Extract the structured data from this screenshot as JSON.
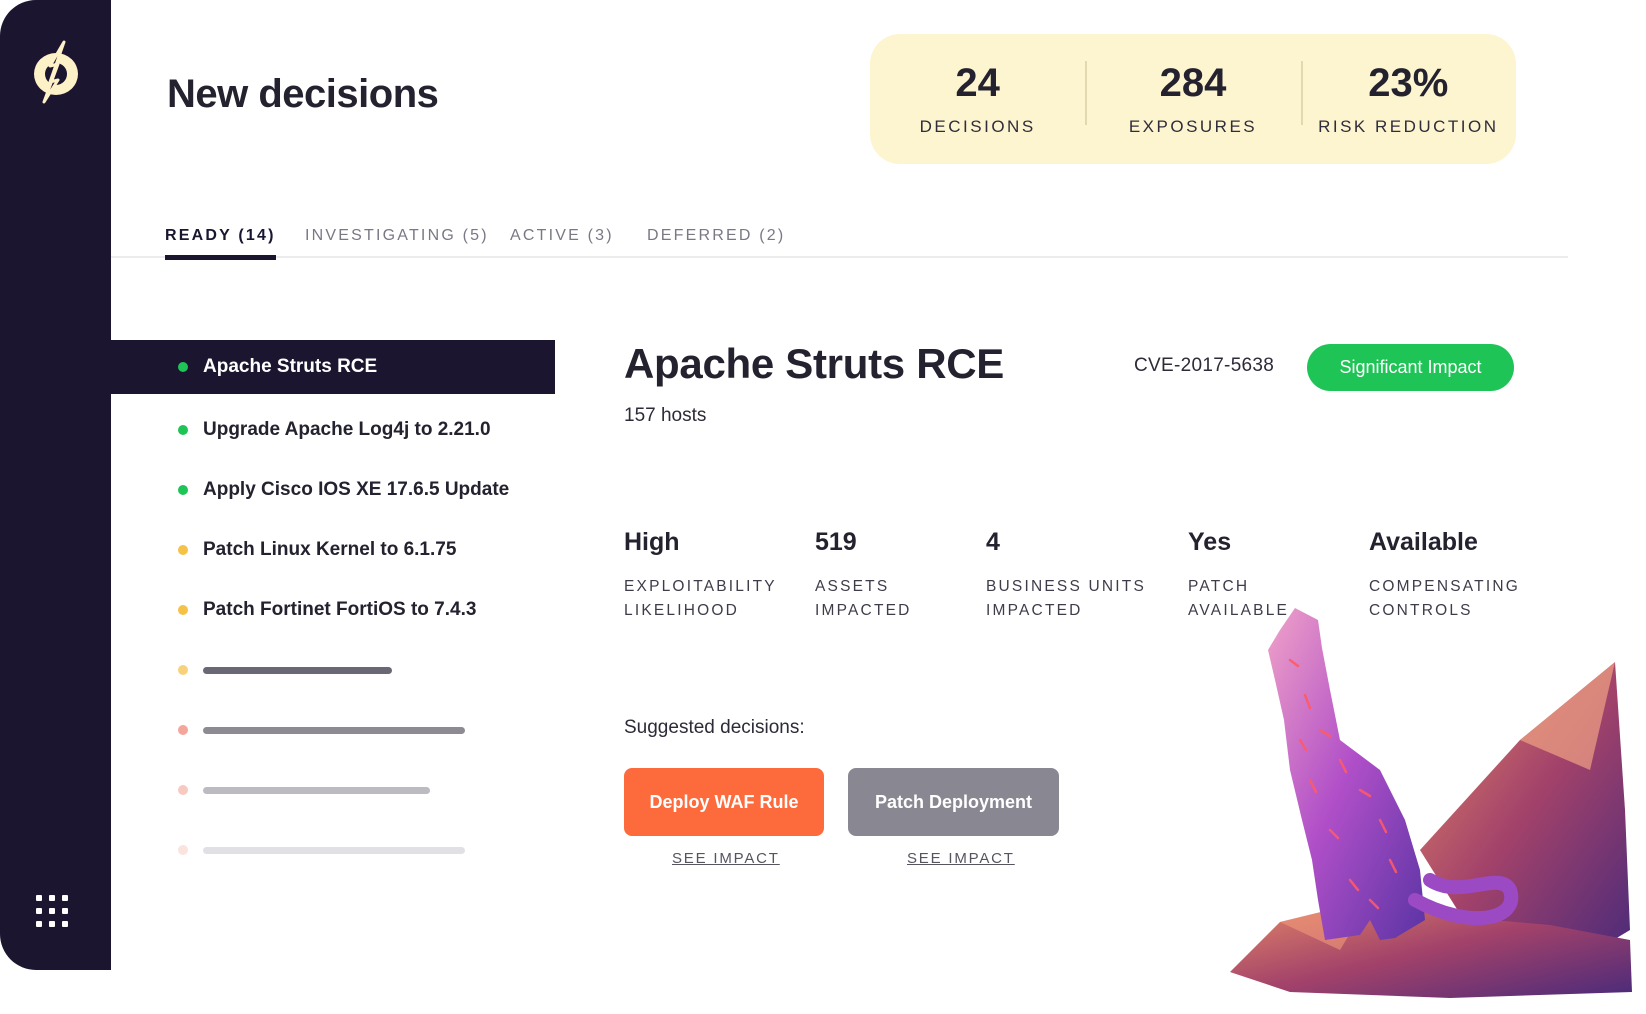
{
  "sidebar": {
    "logo": "slashed-zero-logo",
    "menu_icon": "grid-icon"
  },
  "page_title": "New decisions",
  "stats": [
    {
      "value": "24",
      "label": "DECISIONS"
    },
    {
      "value": "284",
      "label": "EXPOSURES"
    },
    {
      "value": "23%",
      "label": "RISK REDUCTION"
    }
  ],
  "tabs": [
    {
      "label": "READY (14)",
      "active": true
    },
    {
      "label": "INVESTIGATING (5)",
      "active": false
    },
    {
      "label": "ACTIVE (3)",
      "active": false
    },
    {
      "label": "DEFERRED (2)",
      "active": false
    }
  ],
  "decisions": [
    {
      "label": "Apache Struts RCE",
      "dot_color": "#1ec455",
      "selected": true
    },
    {
      "label": "Upgrade Apache Log4j to 2.21.0",
      "dot_color": "#1ec455"
    },
    {
      "label": "Apply Cisco IOS XE 17.6.5 Update",
      "dot_color": "#1ec455"
    },
    {
      "label": "Patch Linux Kernel to 6.1.75",
      "dot_color": "#f4c247"
    },
    {
      "label": "Patch Fortinet FortiOS to 7.4.3",
      "dot_color": "#f4c247"
    }
  ],
  "placeholder_rows": [
    {
      "dot_color": "#f7d27a",
      "bar_color": "#6b6875"
    },
    {
      "dot_color": "#f4a69a",
      "bar_color": "#8d8a94"
    },
    {
      "dot_color": "#f8c9c0",
      "bar_color": "#bdbbc2"
    },
    {
      "dot_color": "#fbe3de",
      "bar_color": "#e1e0e4"
    }
  ],
  "detail": {
    "title": "Apache Struts RCE",
    "hosts": "157 hosts",
    "cve": "CVE-2017-5638",
    "impact_badge": "Significant Impact",
    "impact_color": "#1ec455",
    "metrics": [
      {
        "value": "High",
        "label": "EXPLOITABILITY LIKELIHOOD"
      },
      {
        "value": "519",
        "label": "ASSETS IMPACTED"
      },
      {
        "value": "4",
        "label": "BUSINESS UNITS IMPACTED"
      },
      {
        "value": "Yes",
        "label": "PATCH AVAILABLE"
      },
      {
        "value": "Available",
        "label": "COMPENSATING CONTROLS"
      }
    ],
    "suggested_label": "Suggested decisions:",
    "actions": [
      {
        "label": "Deploy WAF Rule",
        "color": "#fd6a3c",
        "link": "SEE IMPACT"
      },
      {
        "label": "Patch Deployment",
        "color": "#898791",
        "link": "SEE IMPACT"
      }
    ]
  },
  "illustration": "cheetah-on-rock"
}
